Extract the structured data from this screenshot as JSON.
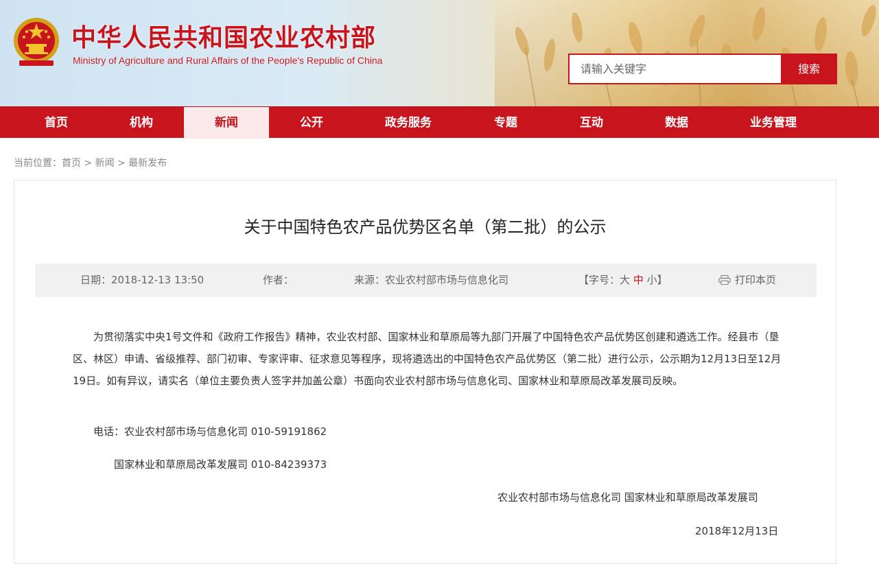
{
  "header": {
    "title": "中华人民共和国农业农村部",
    "subtitle": "Ministry of Agriculture and Rural Affairs of the People's Republic of China",
    "emblem_icon": "national-emblem-icon",
    "search": {
      "placeholder": "请输入关键字",
      "button": "搜索"
    },
    "accent_color": "#c8141c"
  },
  "nav": {
    "items": [
      {
        "label": "首页"
      },
      {
        "label": "机构"
      },
      {
        "label": "新闻"
      },
      {
        "label": "公开"
      },
      {
        "label": "政务服务"
      },
      {
        "label": "专题"
      },
      {
        "label": "互动"
      },
      {
        "label": "数据"
      },
      {
        "label": "业务管理"
      }
    ],
    "active": "新闻"
  },
  "breadcrumb": {
    "prefix": "当前位置：",
    "items": [
      "首页",
      "新闻",
      "最新发布"
    ],
    "separator": ">"
  },
  "article": {
    "title": "关于中国特色农产品优势区名单（第二批）的公示",
    "meta": {
      "date_label": "日期：",
      "date": "2018-12-13 13:50",
      "author_label": "作者：",
      "author": "",
      "source_label": "来源：",
      "source": "农业农村部市场与信息化司",
      "font_size_label": "【字号：",
      "font_sizes": [
        "大",
        "中",
        "小"
      ],
      "font_size_current": "中",
      "font_size_close": "】",
      "print_icon": "printer-icon",
      "print_label": "打印本页"
    },
    "paragraph": "为贯彻落实中央1号文件和《政府工作报告》精神，农业农村部、国家林业和草原局等九部门开展了中国特色农产品优势区创建和遴选工作。经县市（垦区、林区）申请、省级推荐、部门初审、专家评审、征求意见等程序，现将遴选出的中国特色农产品优势区（第二批）进行公示，公示期为12月13日至12月19日。如有异议，请实名（单位主要负责人签字并加盖公章）书面向农业农村部市场与信息化司、国家林业和草原局改革发展司反映。",
    "contact1": "电话：农业农村部市场与信息化司 010-59191862",
    "contact2": "国家林业和草原局改革发展司 010-84239373",
    "signature": "农业农村部市场与信息化司  国家林业和草原局改革发展司",
    "date_sign": "2018年12月13日"
  }
}
